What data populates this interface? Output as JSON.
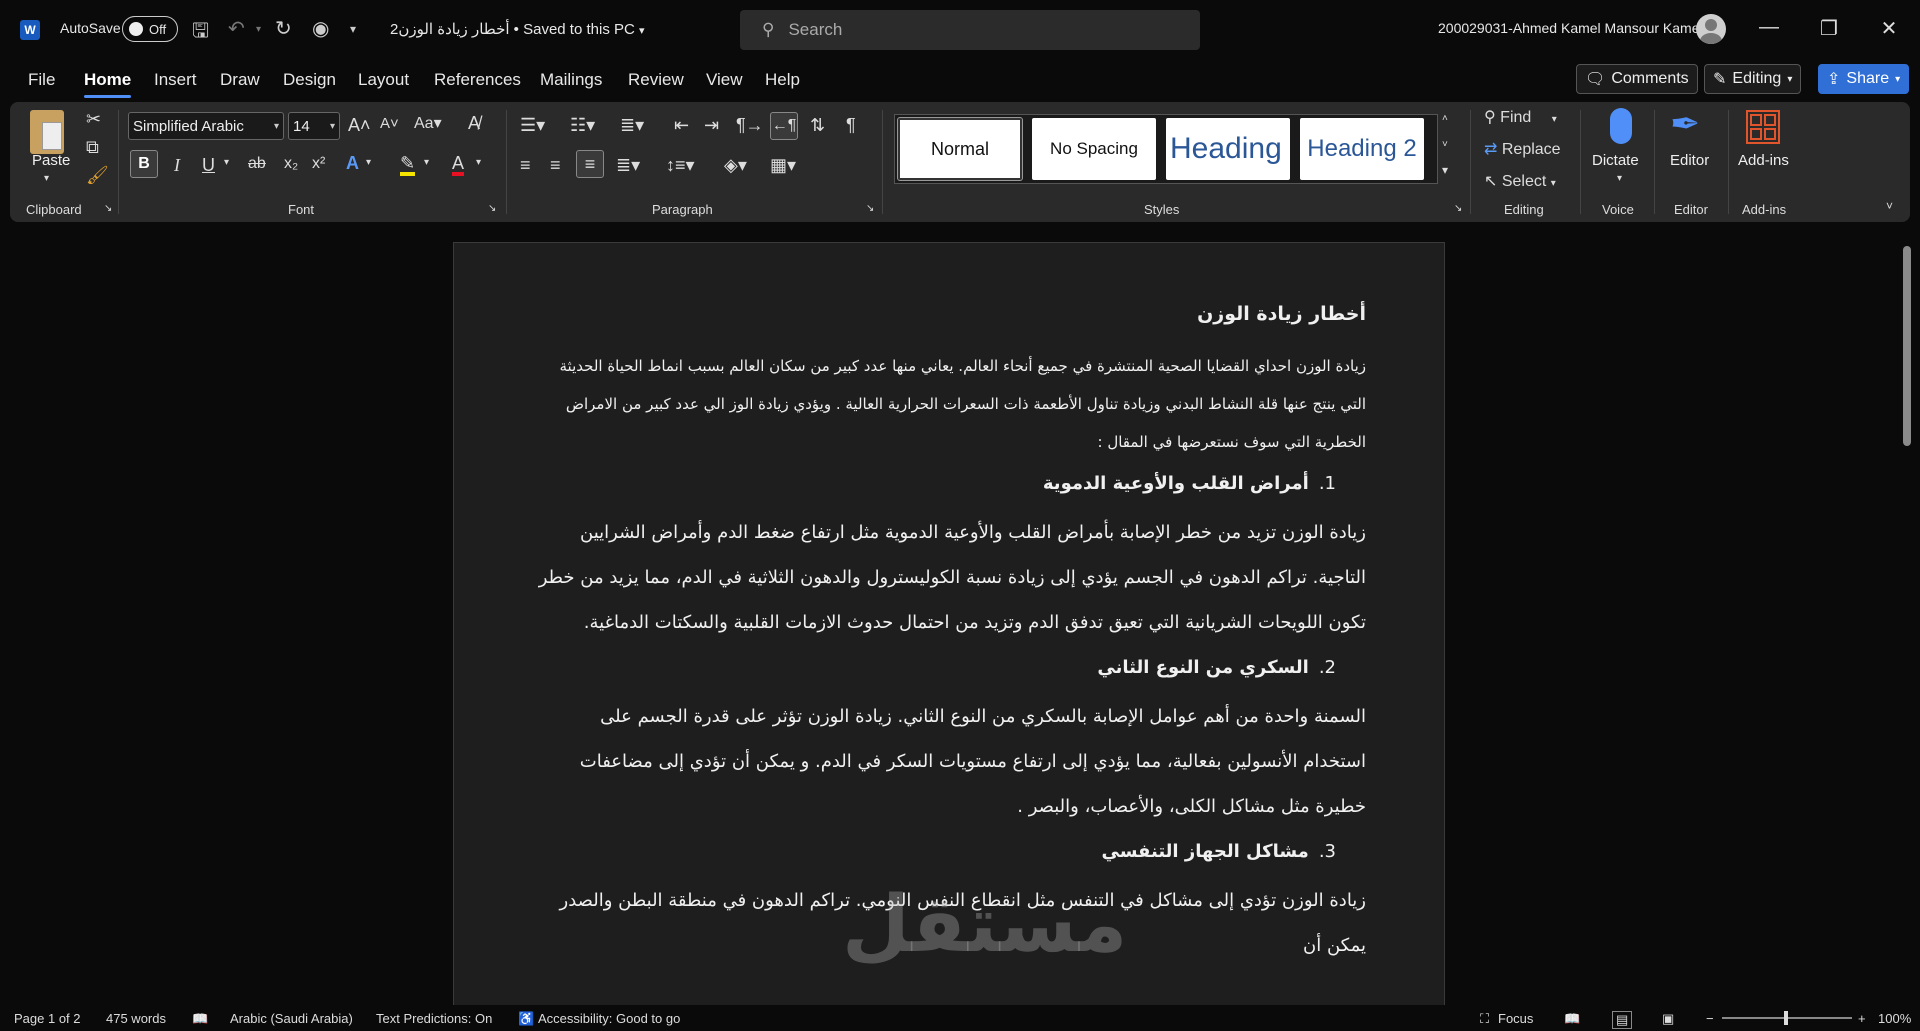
{
  "titlebar": {
    "app_logo": "W",
    "autosave_label": "AutoSave",
    "autosave_state": "Off",
    "doc_title": "أخطار زيادة الوزن2 • Saved to this PC",
    "search_placeholder": "Search",
    "user_name": "200029031-Ahmed Kamel Mansour Kamel"
  },
  "menu": {
    "tabs": [
      "File",
      "Home",
      "Insert",
      "Draw",
      "Design",
      "Layout",
      "References",
      "Mailings",
      "Review",
      "View",
      "Help"
    ],
    "comments_label": "Comments",
    "editing_label": "Editing",
    "share_label": "Share"
  },
  "ribbon": {
    "clipboard": {
      "paste_label": "Paste",
      "group_label": "Clipboard"
    },
    "font": {
      "font_name": "Simplified Arabic",
      "font_size": "14",
      "group_label": "Font"
    },
    "paragraph": {
      "group_label": "Paragraph"
    },
    "styles": {
      "items": [
        "Normal",
        "No Spacing",
        "Heading 1",
        "Heading 2"
      ],
      "group_label": "Styles"
    },
    "editing": {
      "find_label": "Find",
      "replace_label": "Replace",
      "select_label": "Select",
      "group_label": "Editing"
    },
    "voice": {
      "dictate_label": "Dictate",
      "group_label": "Voice"
    },
    "editor": {
      "editor_label": "Editor",
      "group_label": "Editor"
    },
    "addins": {
      "addins_label": "Add-ins",
      "group_label": "Add-ins"
    }
  },
  "document": {
    "title": "أخطار زيادة الوزن",
    "intro": "زيادة الوزن احداي القضايا الصحية المنتشرة في جميع أنحاء العالم. يعاني منها عدد كبير من سكان العالم بسبب انماط الحياة الحديثة التي ينتج عنها قلة النشاط البدني وزيادة تناول الأطعمة ذات السعرات الحرارية العالية . ويؤدي زيادة الوز الي عدد كبير من الامراض الخطرية التي سوف نستعرضها في المقال :",
    "sections": [
      {
        "num": "1.",
        "heading": "أمراض القلب والأوعية الدموية",
        "body": "زيادة الوزن تزيد من خطر الإصابة بأمراض القلب والأوعية الدموية مثل ارتفاع ضغط الدم وأمراض الشرايين التاجية. تراكم الدهون في الجسم يؤدي إلى زيادة نسبة الكوليسترول والدهون الثلاثية في الدم، مما يزيد من خطر تكون اللويحات الشريانية التي تعيق تدفق الدم وتزيد من احتمال حدوث الازمات القلبية والسكتات الدماغية."
      },
      {
        "num": "2.",
        "heading": "السكري من النوع الثاني",
        "body": "السمنة واحدة من أهم عوامل الإصابة بالسكري من النوع الثاني. زيادة الوزن تؤثر على قدرة الجسم على استخدام الأنسولين بفعالية، مما يؤدي إلى ارتفاع مستويات السكر في الدم. و يمكن أن تؤدي إلى مضاعفات خطيرة مثل مشاكل الكلى، والأعصاب، والبصر ."
      },
      {
        "num": "3.",
        "heading": "مشاكل الجهاز التنفسي",
        "body": "زيادة الوزن تؤدي إلى مشاكل في التنفس مثل انقطاع النفس النومي. تراكم الدهون في منطقة البطن والصدر يمكن أن"
      }
    ],
    "watermark": "مستقل"
  },
  "status": {
    "page": "Page 1 of 2",
    "words": "475 words",
    "language": "Arabic (Saudi Arabia)",
    "predictions": "Text Predictions: On",
    "accessibility": "Accessibility: Good to go",
    "focus": "Focus",
    "zoom": "100%"
  },
  "colors": {
    "accent": "#4f8ff7",
    "share": "#2f6fd6",
    "highlight": "#f5e400",
    "font_color": "#e81123"
  }
}
